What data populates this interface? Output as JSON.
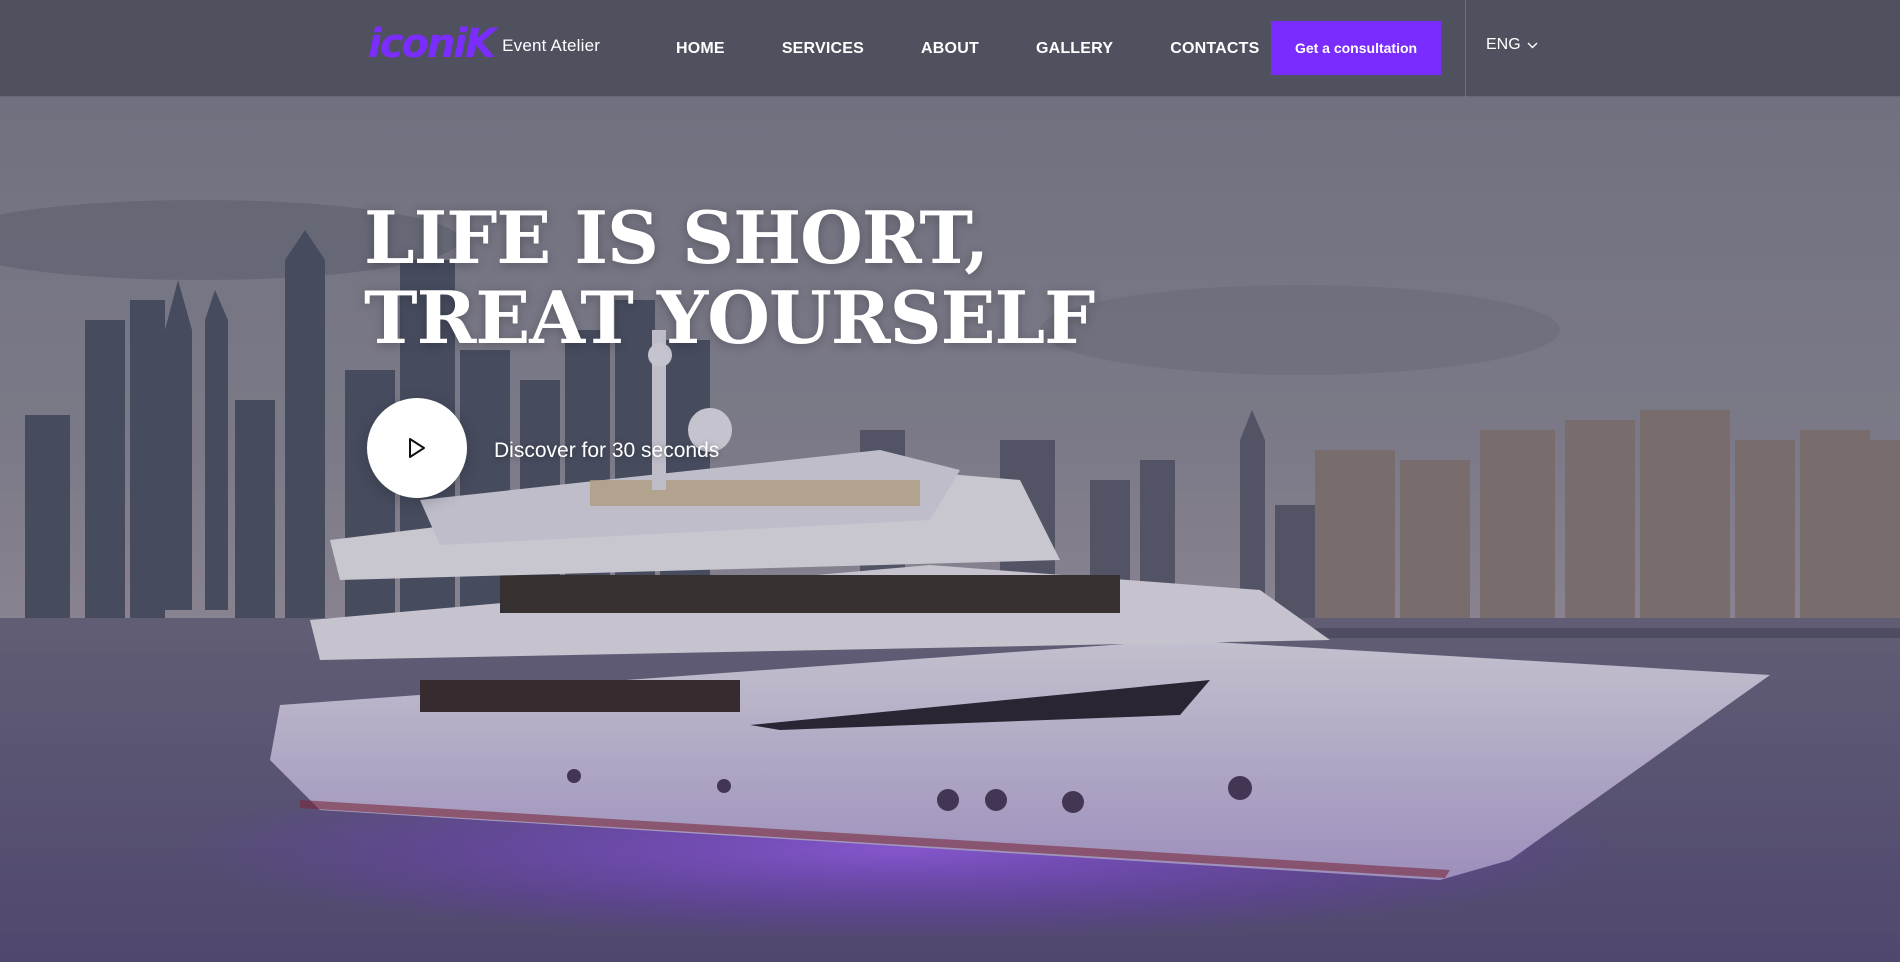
{
  "header": {
    "logo_text": "iconiK",
    "logo_subtitle": "Event Atelier",
    "nav": [
      {
        "label": "HOME"
      },
      {
        "label": "SERVICES"
      },
      {
        "label": "ABOUT"
      },
      {
        "label": "GALLERY"
      },
      {
        "label": "CONTACTS"
      }
    ],
    "cta_label": "Get a consultation",
    "language": "ENG"
  },
  "hero": {
    "headline_line1": "LIFE IS SHORT,",
    "headline_line2": "TREAT YOURSELF",
    "video_label": "Discover for 30 seconds",
    "play_icon": "play-icon",
    "background_description_icon": "yacht-skyline-photo"
  },
  "colors": {
    "accent": "#7a2cff",
    "header_bg": "#484a58",
    "text": "#ffffff"
  }
}
